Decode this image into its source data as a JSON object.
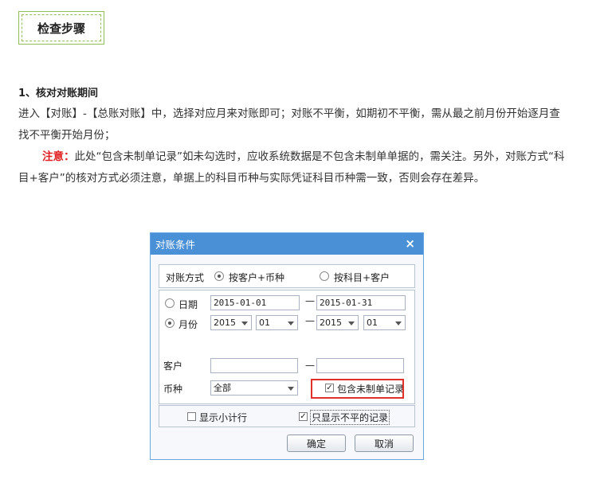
{
  "heading": "检查步骤",
  "section_title": "1、核对对账期间",
  "para1": "进入【对账】-【总账对账】中，选择对应月来对账即可；对账不平衡，如期初不平衡，需从最之前月份开始逐月查找不平衡开始月份；",
  "para2_warn": "注意：",
  "para2_text": "此处“包含未制单记录”如未勾选时，应收系统数据是不包含未制单单据的，需关注。另外，对账方式“科目+客户”的核对方式必须注意，单据上的科目币种与实际凭证科目币种需一致，否则会存在差异。",
  "dialog": {
    "title": "对账条件",
    "close": "×",
    "mode_label": "对账方式",
    "mode_option1": "按客户+币种",
    "mode_option2": "按科目+客户",
    "date_label": "日期",
    "date_from": "2015-01-01",
    "date_to": "2015-01-31",
    "month_label": "月份",
    "year_from": "2015",
    "month_from": "01",
    "year_to": "2015",
    "month_to": "01",
    "separator": "—",
    "customer_label": "客户",
    "customer_from": "",
    "customer_to": "",
    "currency_label": "币种",
    "currency_value": "全部",
    "include_unposted": "包含未制单记录",
    "show_subtotal": "显示小计行",
    "only_unbalanced": "只显示不平的记录",
    "ok": "确定",
    "cancel": "取消",
    "checkmark": "✓"
  }
}
